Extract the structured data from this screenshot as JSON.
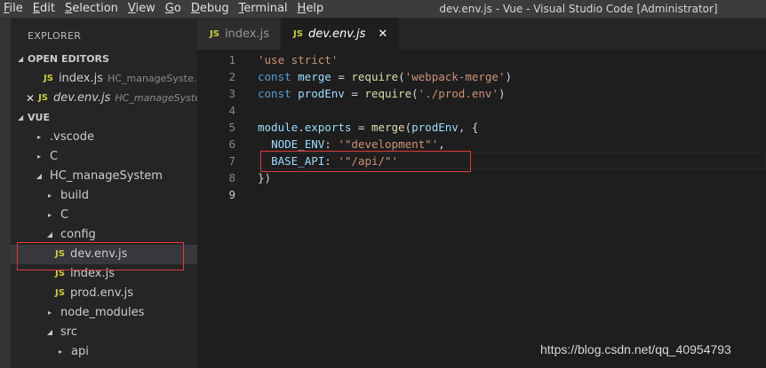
{
  "menu": [
    "File",
    "Edit",
    "Selection",
    "View",
    "Go",
    "Debug",
    "Terminal",
    "Help"
  ],
  "menu_underline": [
    "F",
    "E",
    "S",
    "V",
    "G",
    "D",
    "T",
    "H"
  ],
  "window_title": "dev.env.js - Vue - Visual Studio Code [Administrator]",
  "sidebar": {
    "title": "EXPLORER",
    "open_editors_header": "OPEN EDITORS",
    "open_editors": [
      {
        "name": "index.js",
        "path": "HC_manageSyste..."
      },
      {
        "name": "dev.env.js",
        "path": "HC_manageSyste...",
        "close": "✕"
      }
    ],
    "project_header": "VUE",
    "tree": [
      {
        "label": ".vscode",
        "depth": 0,
        "arrow": "▸"
      },
      {
        "label": "C",
        "depth": 0,
        "arrow": "▸"
      },
      {
        "label": "HC_manageSystem",
        "depth": 0,
        "arrow": "◢"
      },
      {
        "label": "build",
        "depth": 1,
        "arrow": "▸"
      },
      {
        "label": "C",
        "depth": 1,
        "arrow": "▸"
      },
      {
        "label": "config",
        "depth": 1,
        "arrow": "◢"
      },
      {
        "label": "dev.env.js",
        "depth": 2,
        "js": true
      },
      {
        "label": "index.js",
        "depth": 2,
        "js": true
      },
      {
        "label": "prod.env.js",
        "depth": 2,
        "js": true
      },
      {
        "label": "node_modules",
        "depth": 1,
        "arrow": "▸"
      },
      {
        "label": "src",
        "depth": 1,
        "arrow": "◢"
      },
      {
        "label": "api",
        "depth": 2,
        "arrow": "▸"
      }
    ]
  },
  "tabs": [
    {
      "label": "index.js",
      "badge": "JS"
    },
    {
      "label": "dev.env.js",
      "badge": "JS",
      "close": "✕"
    }
  ],
  "code_lines": [
    [
      {
        "t": "'use strict'",
        "c": "str"
      }
    ],
    [
      {
        "t": "const ",
        "c": "kw"
      },
      {
        "t": "merge",
        "c": "var"
      },
      {
        "t": " = ",
        "c": "plain"
      },
      {
        "t": "require",
        "c": "fn"
      },
      {
        "t": "(",
        "c": "plain"
      },
      {
        "t": "'webpack-merge'",
        "c": "str"
      },
      {
        "t": ")",
        "c": "plain"
      }
    ],
    [
      {
        "t": "const ",
        "c": "kw"
      },
      {
        "t": "prodEnv",
        "c": "var"
      },
      {
        "t": " = ",
        "c": "plain"
      },
      {
        "t": "require",
        "c": "fn"
      },
      {
        "t": "(",
        "c": "plain"
      },
      {
        "t": "'./prod.env'",
        "c": "str"
      },
      {
        "t": ")",
        "c": "plain"
      }
    ],
    [],
    [
      {
        "t": "module",
        "c": "var"
      },
      {
        "t": ".",
        "c": "plain"
      },
      {
        "t": "exports",
        "c": "var"
      },
      {
        "t": " = ",
        "c": "plain"
      },
      {
        "t": "merge",
        "c": "fn"
      },
      {
        "t": "(",
        "c": "plain"
      },
      {
        "t": "prodEnv",
        "c": "var"
      },
      {
        "t": ", {",
        "c": "plain"
      }
    ],
    [
      {
        "t": "  ",
        "c": "plain"
      },
      {
        "t": "NODE_ENV",
        "c": "var"
      },
      {
        "t": ": ",
        "c": "plain"
      },
      {
        "t": "'\"development\"'",
        "c": "str"
      },
      {
        "t": ",",
        "c": "plain"
      }
    ],
    [
      {
        "t": "  ",
        "c": "plain"
      },
      {
        "t": "BASE_API",
        "c": "var"
      },
      {
        "t": ": ",
        "c": "plain"
      },
      {
        "t": "'\"/api/\"'",
        "c": "str"
      }
    ],
    [
      {
        "t": "})",
        "c": "plain"
      }
    ],
    []
  ],
  "watermark": "https://blog.csdn.net/qq_40954793",
  "colors": {
    "accent_box": "#e03a3a",
    "js_badge": "#cbcb41"
  }
}
